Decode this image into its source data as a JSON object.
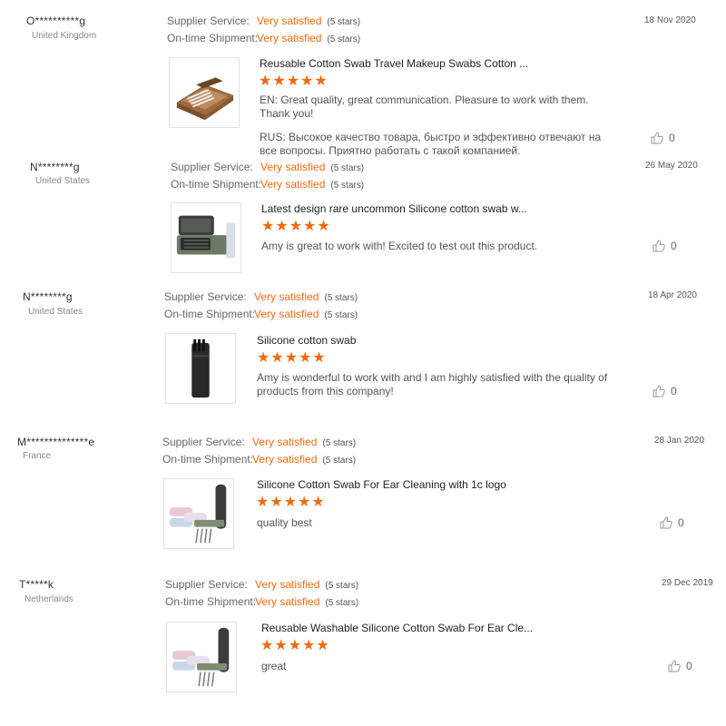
{
  "labels": {
    "supplier": "Supplier Service:",
    "shipment": "On-time Shipment:"
  },
  "reviews": [
    {
      "name": "O**********g",
      "country": "United Kingdom",
      "supplier_value": "Very satisfied",
      "supplier_stars": "(5 stars)",
      "shipment_value": "Very satisfied",
      "shipment_stars": "(5 stars)",
      "date": "18 Nov 2020",
      "product_title": "Reusable Cotton Swab Travel Makeup Swabs Cotton ...",
      "rating": 5,
      "stars": "★★★★★",
      "text": [
        "EN: Great quality, great communication. Pleasure to work with them. Thank you!",
        "RUS: Высокое качество товара, быстро и эффективно отвечают на все вопросы. Приятно работать с такой компанией."
      ],
      "likes": "0",
      "thumb_icon": "wooden-swab-box"
    },
    {
      "name": "N********g",
      "country": "United States",
      "supplier_value": "Very satisfied",
      "supplier_stars": "(5 stars)",
      "shipment_value": "Very satisfied",
      "shipment_stars": "(5 stars)",
      "date": "26 May 2020",
      "product_title": "Latest design rare uncommon Silicone cotton swab w...",
      "rating": 5,
      "stars": "★★★★★",
      "text": [
        "Amy is great to work with! Excited to test out this product."
      ],
      "likes": "0",
      "thumb_icon": "green-swab-case"
    },
    {
      "name": "N********g",
      "country": "United States",
      "supplier_value": "Very satisfied",
      "supplier_stars": "(5 stars)",
      "shipment_value": "Very satisfied",
      "shipment_stars": "(5 stars)",
      "date": "18 Apr 2020",
      "product_title": "Silicone cotton swab",
      "rating": 5,
      "stars": "★★★★★",
      "text": [
        "Amy is wonderful to work with and I am highly satisfied with the quality of products from this company!"
      ],
      "likes": "0",
      "thumb_icon": "black-swab-case"
    },
    {
      "name": "M**************e",
      "country": "France",
      "supplier_value": "Very satisfied",
      "supplier_stars": "(5 stars)",
      "shipment_value": "Very satisfied",
      "shipment_stars": "(5 stars)",
      "date": "28 Jan 2020",
      "product_title": "Silicone Cotton Swab For Ear Cleaning with 1c logo",
      "rating": 5,
      "stars": "★★★★★",
      "text": [
        "quality best"
      ],
      "likes": "0",
      "thumb_icon": "pastel-swab-cases"
    },
    {
      "name": "T*****k",
      "country": "Netherlands",
      "supplier_value": "Very satisfied",
      "supplier_stars": "(5 stars)",
      "shipment_value": "Very satisfied",
      "shipment_stars": "(5 stars)",
      "date": "29 Dec 2019",
      "product_title": "Reusable Washable Silicone Cotton Swab For Ear Cle...",
      "rating": 5,
      "stars": "★★★★★",
      "text": [
        "great"
      ],
      "likes": "0",
      "thumb_icon": "pastel-swab-cases"
    }
  ]
}
